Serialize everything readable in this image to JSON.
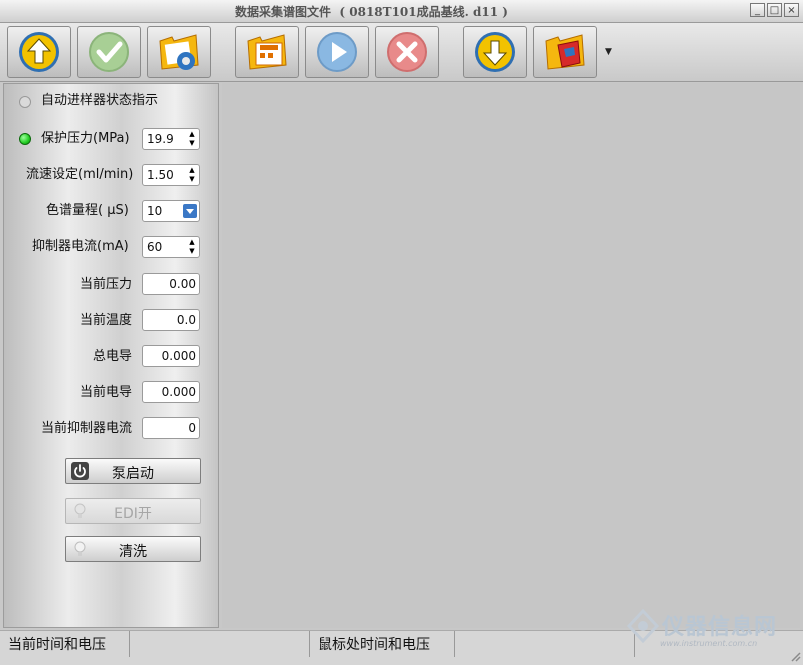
{
  "window": {
    "title": "数据采集谱图文件  ( 0818T101成品基线. d11 )",
    "minimize_glyph": "_",
    "maximize_glyph": "□",
    "close_glyph": "×"
  },
  "toolbar": {
    "buttons": [
      {
        "icon": "upload-arrow-icon",
        "color": "#f2c200",
        "enabled": true
      },
      {
        "icon": "checkmark-icon",
        "color": "#7fbf62",
        "enabled": false
      },
      {
        "icon": "folder-settings-icon",
        "color": "#f2a000",
        "enabled": true
      },
      {
        "icon": "folder-grid-icon",
        "color": "#f2a000",
        "enabled": true
      },
      {
        "icon": "play-icon",
        "color": "#6fa7d8",
        "enabled": false
      },
      {
        "icon": "stop-x-icon",
        "color": "#e06b6b",
        "enabled": false
      },
      {
        "icon": "download-arrow-icon",
        "color": "#f2c200",
        "enabled": true
      },
      {
        "icon": "folder-book-icon",
        "color": "#d62a2a",
        "enabled": true
      }
    ],
    "dropdown_glyph": "▼"
  },
  "panel": {
    "autosampler": {
      "label": "自动进样器状态指示",
      "led_color": "#d8d8d8"
    },
    "protect_pressure": {
      "label": "保护压力(MPa)",
      "value": "19.9",
      "led_color": "#22cc22"
    },
    "flow_rate": {
      "label": "流速设定(ml/min)",
      "value": "1.50"
    },
    "range": {
      "label": "色谱量程( μS)",
      "value": "10"
    },
    "suppressor_current": {
      "label": "抑制器电流(mA)",
      "value": "60"
    },
    "current_pressure": {
      "label": "当前压力",
      "value": "0.00"
    },
    "current_temp": {
      "label": "当前温度",
      "value": "0.0"
    },
    "total_conductance": {
      "label": "总电导",
      "value": "0.000"
    },
    "current_conductance": {
      "label": "当前电导",
      "value": "0.000"
    },
    "current_suppressor_current": {
      "label": "当前抑制器电流",
      "value": "0"
    },
    "pump_button": {
      "label": "泵启动",
      "enabled": true
    },
    "edi_button": {
      "label": "EDI开",
      "enabled": false
    },
    "clean_button": {
      "label": "清洗",
      "enabled": true
    }
  },
  "status": {
    "time_voltage": "当前时间和电压",
    "mouse_time_voltage": "鼠标处时间和电压"
  },
  "watermark": {
    "text": "仪器信息网",
    "url": "www.instrument.com.cn"
  }
}
